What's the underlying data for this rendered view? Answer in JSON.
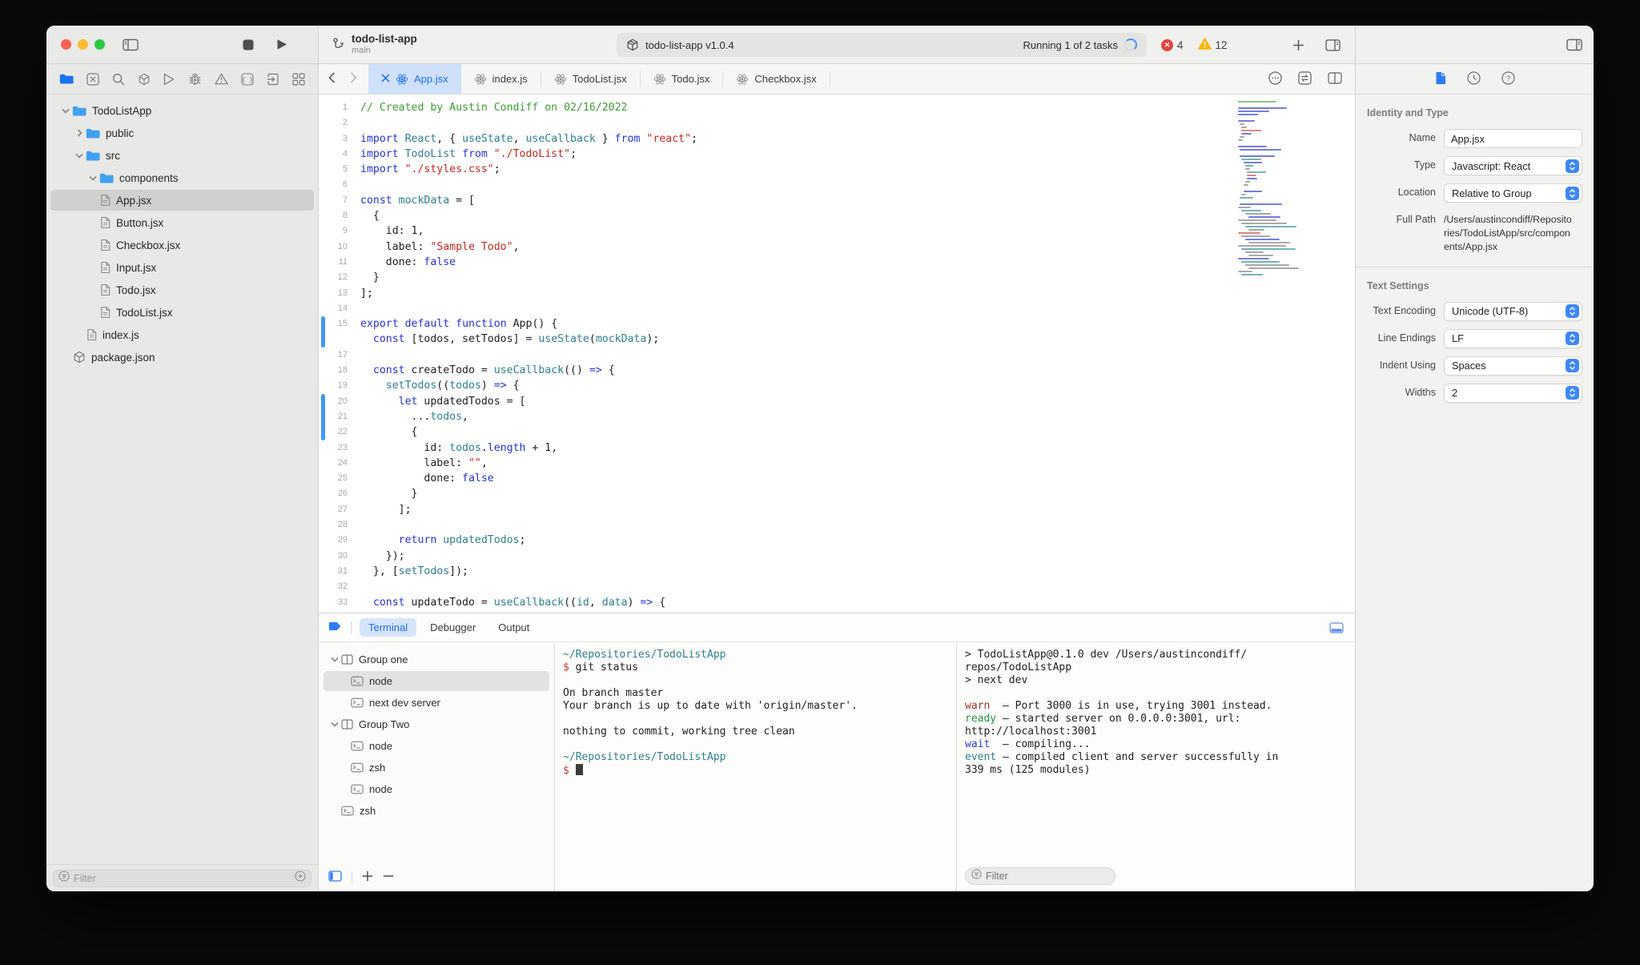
{
  "toolbar": {
    "project_name": "todo-list-app",
    "branch": "main",
    "scheme_label": "todo-list-app v1.0.4",
    "status_label": "Running 1 of 2 tasks",
    "error_count": "4",
    "warning_count": "12",
    "accent_color": "#2f7bf6",
    "error_color": "#e2443c",
    "warning_color": "#f7b500"
  },
  "navigator": {
    "icons": [
      "folder",
      "square-x",
      "search",
      "package",
      "play-outline",
      "bug",
      "warning-outline",
      "braces",
      "provision",
      "grid"
    ],
    "active_icon": "folder",
    "tree": [
      {
        "depth": 0,
        "kind": "folder",
        "expanded": true,
        "label": "TodoListApp"
      },
      {
        "depth": 1,
        "kind": "folder",
        "expanded": false,
        "label": "public"
      },
      {
        "depth": 1,
        "kind": "folder",
        "expanded": true,
        "label": "src"
      },
      {
        "depth": 2,
        "kind": "folder",
        "expanded": true,
        "label": "components"
      },
      {
        "depth": 3,
        "kind": "file",
        "label": "App.jsx",
        "selected": true
      },
      {
        "depth": 3,
        "kind": "file",
        "label": "Button.jsx"
      },
      {
        "depth": 3,
        "kind": "file",
        "label": "Checkbox.jsx"
      },
      {
        "depth": 3,
        "kind": "file",
        "label": "Input.jsx"
      },
      {
        "depth": 3,
        "kind": "file",
        "label": "Todo.jsx"
      },
      {
        "depth": 3,
        "kind": "file",
        "label": "TodoList.jsx"
      },
      {
        "depth": 2,
        "kind": "file",
        "label": "index.js"
      },
      {
        "depth": 1,
        "kind": "package",
        "label": "package.json"
      }
    ],
    "filter_placeholder": "Filter"
  },
  "tabs": [
    {
      "label": "App.jsx",
      "active": true
    },
    {
      "label": "index.js",
      "active": false
    },
    {
      "label": "TodoList.jsx",
      "active": false
    },
    {
      "label": "Todo.jsx",
      "active": false
    },
    {
      "label": "Checkbox.jsx",
      "active": false
    }
  ],
  "editor": {
    "hidden_line_numbers": [
      16
    ],
    "change_bars": [
      {
        "from": 15,
        "to": 16
      },
      {
        "from": 20,
        "to": 22
      }
    ],
    "lines": [
      [
        [
          "com",
          "// Created by Austin Condiff on 02/16/2022"
        ]
      ],
      [],
      [
        [
          "kw",
          "import"
        ],
        [
          "pl",
          " "
        ],
        [
          "id",
          "React"
        ],
        [
          "pl",
          ", { "
        ],
        [
          "id",
          "useState"
        ],
        [
          "pl",
          ", "
        ],
        [
          "id",
          "useCallback"
        ],
        [
          "pl",
          " } "
        ],
        [
          "kw",
          "from"
        ],
        [
          "pl",
          " "
        ],
        [
          "str",
          "\"react\""
        ],
        [
          "pl",
          ";"
        ]
      ],
      [
        [
          "kw",
          "import"
        ],
        [
          "pl",
          " "
        ],
        [
          "id",
          "TodoList"
        ],
        [
          "pl",
          " "
        ],
        [
          "kw",
          "from"
        ],
        [
          "pl",
          " "
        ],
        [
          "str",
          "\"./TodoList\""
        ],
        [
          "pl",
          ";"
        ]
      ],
      [
        [
          "kw",
          "import"
        ],
        [
          "pl",
          " "
        ],
        [
          "str",
          "\"./styles.css\""
        ],
        [
          "pl",
          ";"
        ]
      ],
      [],
      [
        [
          "kw",
          "const"
        ],
        [
          "pl",
          " "
        ],
        [
          "id",
          "mockData"
        ],
        [
          "pl",
          " = ["
        ]
      ],
      [
        [
          "pl",
          "  {"
        ]
      ],
      [
        [
          "pl",
          "    id: 1,"
        ]
      ],
      [
        [
          "pl",
          "    label: "
        ],
        [
          "str",
          "\"Sample Todo\""
        ],
        [
          "pl",
          ","
        ]
      ],
      [
        [
          "pl",
          "    done: "
        ],
        [
          "kw",
          "false"
        ]
      ],
      [
        [
          "pl",
          "  }"
        ]
      ],
      [
        [
          "pl",
          "];"
        ]
      ],
      [],
      [
        [
          "kw",
          "export"
        ],
        [
          "pl",
          " "
        ],
        [
          "kw",
          "default"
        ],
        [
          "pl",
          " "
        ],
        [
          "kw",
          "function"
        ],
        [
          "pl",
          " App() {"
        ]
      ],
      [
        [
          "pl",
          "  "
        ],
        [
          "kw",
          "const"
        ],
        [
          "pl",
          " [todos, setTodos] = "
        ],
        [
          "id",
          "useState"
        ],
        [
          "pl",
          "("
        ],
        [
          "id",
          "mockData"
        ],
        [
          "pl",
          ");"
        ]
      ],
      [],
      [
        [
          "pl",
          "  "
        ],
        [
          "kw",
          "const"
        ],
        [
          "pl",
          " createTodo = "
        ],
        [
          "id",
          "useCallback"
        ],
        [
          "pl",
          "(() "
        ],
        [
          "kw",
          "=>"
        ],
        [
          "pl",
          " {"
        ]
      ],
      [
        [
          "pl",
          "    "
        ],
        [
          "id",
          "setTodos"
        ],
        [
          "pl",
          "(("
        ],
        [
          "id",
          "todos"
        ],
        [
          "pl",
          ") "
        ],
        [
          "kw",
          "=>"
        ],
        [
          "pl",
          " {"
        ]
      ],
      [
        [
          "pl",
          "      "
        ],
        [
          "kw",
          "let"
        ],
        [
          "pl",
          " updatedTodos = ["
        ]
      ],
      [
        [
          "pl",
          "        ..."
        ],
        [
          "id",
          "todos"
        ],
        [
          "pl",
          ","
        ]
      ],
      [
        [
          "pl",
          "        {"
        ]
      ],
      [
        [
          "pl",
          "          id: "
        ],
        [
          "id",
          "todos"
        ],
        [
          "pl",
          "."
        ],
        [
          "kw",
          "length"
        ],
        [
          "pl",
          " + 1,"
        ]
      ],
      [
        [
          "pl",
          "          label: "
        ],
        [
          "str",
          "\"\""
        ],
        [
          "pl",
          ","
        ]
      ],
      [
        [
          "pl",
          "          done: "
        ],
        [
          "kw",
          "false"
        ]
      ],
      [
        [
          "pl",
          "        }"
        ]
      ],
      [
        [
          "pl",
          "      ];"
        ]
      ],
      [],
      [
        [
          "pl",
          "      "
        ],
        [
          "kw",
          "return"
        ],
        [
          "pl",
          " "
        ],
        [
          "id",
          "updatedTodos"
        ],
        [
          "pl",
          ";"
        ]
      ],
      [
        [
          "pl",
          "    });"
        ]
      ],
      [
        [
          "pl",
          "  }, ["
        ],
        [
          "id",
          "setTodos"
        ],
        [
          "pl",
          "]);"
        ]
      ],
      [],
      [
        [
          "pl",
          "  "
        ],
        [
          "kw",
          "const"
        ],
        [
          "pl",
          " updateTodo = "
        ],
        [
          "id",
          "useCallback"
        ],
        [
          "pl",
          "(("
        ],
        [
          "id",
          "id"
        ],
        [
          "pl",
          ", "
        ],
        [
          "id",
          "data"
        ],
        [
          "pl",
          ") "
        ],
        [
          "kw",
          "=>"
        ],
        [
          "pl",
          " {"
        ]
      ]
    ]
  },
  "bottom_panel": {
    "tabs": [
      {
        "label": "Terminal",
        "active": true
      },
      {
        "label": "Debugger",
        "active": false
      },
      {
        "label": "Output",
        "active": false
      }
    ],
    "sessions": [
      {
        "depth": 0,
        "kind": "group",
        "expanded": true,
        "label": "Group one"
      },
      {
        "depth": 1,
        "kind": "term",
        "label": "node",
        "selected": true
      },
      {
        "depth": 1,
        "kind": "term",
        "label": "next dev server"
      },
      {
        "depth": 0,
        "kind": "group",
        "expanded": true,
        "label": "Group Two"
      },
      {
        "depth": 1,
        "kind": "term",
        "label": "node"
      },
      {
        "depth": 1,
        "kind": "term",
        "label": "zsh"
      },
      {
        "depth": 1,
        "kind": "term",
        "label": "node"
      },
      {
        "depth": 0,
        "kind": "term",
        "label": "zsh"
      }
    ],
    "terminal_left": [
      [
        [
          "path",
          "~/Repositories/TodoListApp"
        ]
      ],
      [
        [
          "prompt",
          "$"
        ],
        [
          "pl",
          " git status"
        ]
      ],
      [],
      [
        [
          "pl",
          "On branch master"
        ]
      ],
      [
        [
          "pl",
          "Your branch is up to date with 'origin/master'."
        ]
      ],
      [],
      [
        [
          "pl",
          "nothing to commit, working tree clean"
        ]
      ],
      [],
      [
        [
          "path",
          "~/Repositories/TodoListApp"
        ]
      ],
      [
        [
          "prompt",
          "$"
        ],
        [
          "pl",
          " "
        ],
        [
          "cursor",
          ""
        ]
      ]
    ],
    "terminal_right": [
      [
        [
          "pl",
          "> TodoListApp@0.1.0 dev /Users/austincondiff/"
        ]
      ],
      [
        [
          "pl",
          "repos/TodoListApp"
        ]
      ],
      [
        [
          "pl",
          "> next dev"
        ]
      ],
      [],
      [
        [
          "warn",
          "warn"
        ],
        [
          "pl",
          "  – Port 3000 is in use, trying 3001 instead."
        ]
      ],
      [
        [
          "ready",
          "ready"
        ],
        [
          "pl",
          " – started server on 0.0.0.0:3001, url:"
        ]
      ],
      [
        [
          "pl",
          "http://localhost:3001"
        ]
      ],
      [
        [
          "wait",
          "wait"
        ],
        [
          "pl",
          "  – compiling..."
        ]
      ],
      [
        [
          "event",
          "event"
        ],
        [
          "pl",
          " – compiled client and server successfully in"
        ]
      ],
      [
        [
          "pl",
          "339 ms (125 modules)"
        ]
      ]
    ],
    "filter_placeholder": "Filter"
  },
  "inspector": {
    "sections": [
      {
        "title": "Identity and Type",
        "rows": [
          {
            "label": "Name",
            "type": "input",
            "value": "App.jsx"
          },
          {
            "label": "Type",
            "type": "select",
            "value": "Javascript: React"
          },
          {
            "label": "Location",
            "type": "select",
            "value": "Relative to Group"
          },
          {
            "label": "Full Path",
            "type": "static",
            "value": "/Users/austincondiff/Repositories/TodoListApp/src/components/App.jsx"
          }
        ]
      },
      {
        "title": "Text Settings",
        "rows": [
          {
            "label": "Text Encoding",
            "type": "select",
            "value": "Unicode (UTF-8)"
          },
          {
            "label": "Line Endings",
            "type": "select",
            "value": "LF"
          },
          {
            "label": "Indent Using",
            "type": "select",
            "value": "Spaces"
          },
          {
            "label": "Widths",
            "type": "select",
            "value": "2"
          }
        ]
      }
    ]
  }
}
